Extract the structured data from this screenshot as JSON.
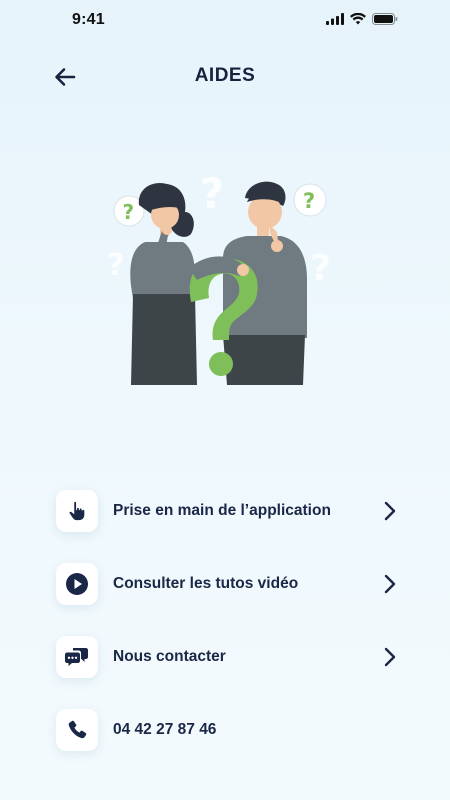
{
  "status_bar": {
    "time": "9:41"
  },
  "header": {
    "title": "AIDES"
  },
  "menu": {
    "items": [
      {
        "label": "Prise en main de l’application",
        "icon": "hand-pointer-icon"
      },
      {
        "label": "Consulter les tutos vidéo",
        "icon": "play-circle-icon"
      },
      {
        "label": "Nous contacter",
        "icon": "chat-bubbles-icon"
      },
      {
        "label": "04 42 27 87 46",
        "icon": "phone-icon"
      }
    ]
  },
  "colors": {
    "primary": "#1a2746",
    "accent_green": "#7fbf5a",
    "figure_gray": "#6f7b80",
    "background": "#e8f4fb"
  }
}
